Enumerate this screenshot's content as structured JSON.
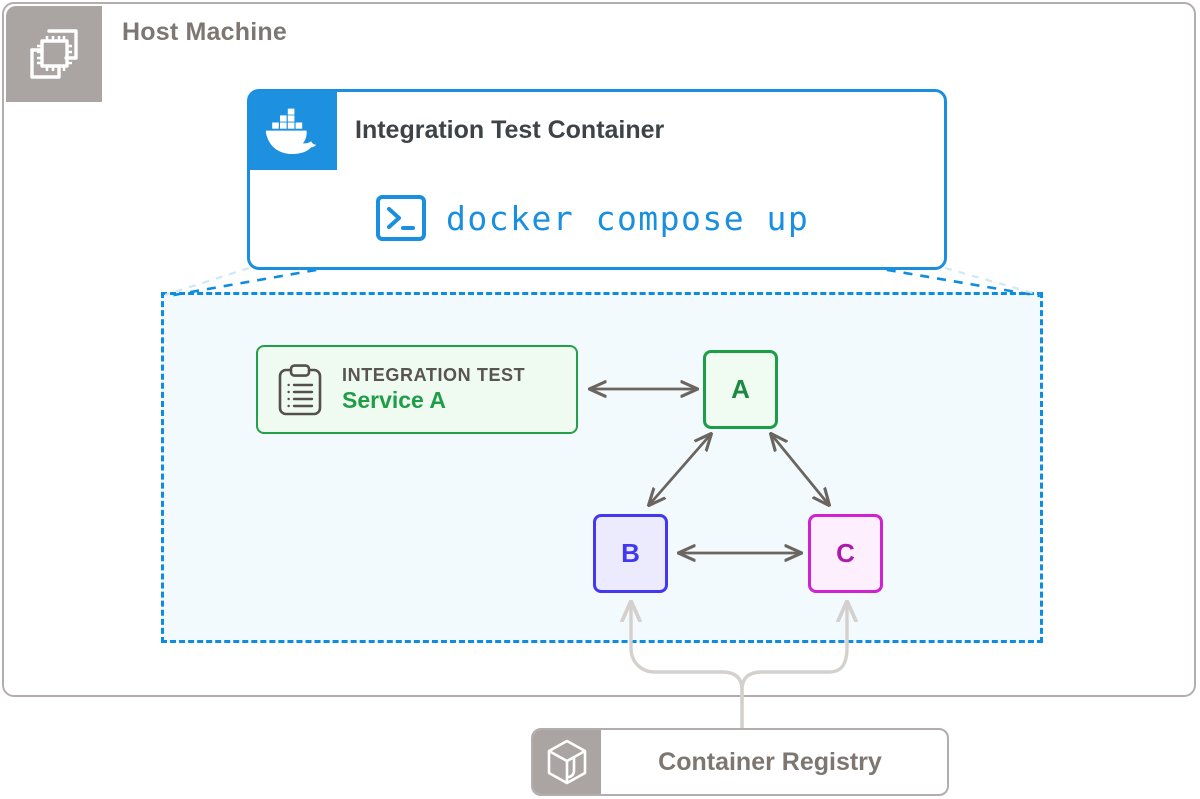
{
  "host": {
    "title": "Host Machine",
    "icon": "cpu-chip-icon",
    "badge_color": "#aaa5a2",
    "border_color": "#b3aead",
    "title_color": "#7d7671"
  },
  "test_container": {
    "title": "Integration Test Container",
    "icon": "docker-whale-icon",
    "border_color": "#1a8fe0",
    "badge_color": "#1d91e0",
    "command": {
      "icon": "terminal-prompt-icon",
      "text": "docker compose up",
      "color": "#1a8fe0"
    }
  },
  "compose_network": {
    "border_color": "#0d8ce0",
    "fill_color": "#f3fafd",
    "style": "dashed"
  },
  "service_card": {
    "icon": "clipboard-list-icon",
    "kicker": "INTEGRATION TEST",
    "name": "Service A",
    "border_color": "#22a04a",
    "fill_color": "#effaf1",
    "kicker_color": "#585450",
    "name_color": "#1f9d47"
  },
  "nodes": [
    {
      "id": "a",
      "label": "A",
      "border_color": "#1b9e45",
      "fill_color": "#f0fbf2",
      "text_color": "#1b8a42"
    },
    {
      "id": "b",
      "label": "B",
      "border_color": "#4338ef",
      "fill_color": "#eceafd",
      "text_color": "#4338ef"
    },
    {
      "id": "c",
      "label": "C",
      "border_color": "#d022d0",
      "fill_color": "#fdeffd",
      "text_color": "#ac1bac"
    }
  ],
  "connections": [
    {
      "from": "service-card",
      "to": "A",
      "type": "bidirectional",
      "color": "#6b6560"
    },
    {
      "from": "A",
      "to": "B",
      "type": "bidirectional",
      "color": "#6b6560"
    },
    {
      "from": "A",
      "to": "C",
      "type": "bidirectional",
      "color": "#6b6560"
    },
    {
      "from": "B",
      "to": "C",
      "type": "bidirectional",
      "color": "#6b6560"
    },
    {
      "from": "Container Registry",
      "to": "B",
      "type": "pull",
      "color": "#d4d0cd"
    },
    {
      "from": "Container Registry",
      "to": "C",
      "type": "pull",
      "color": "#d4d0cd"
    }
  ],
  "registry": {
    "label": "Container Registry",
    "icon": "cube-3d-icon",
    "border_color": "#b3aead",
    "badge_color": "#aaa5a2",
    "label_color": "#7d7671"
  }
}
